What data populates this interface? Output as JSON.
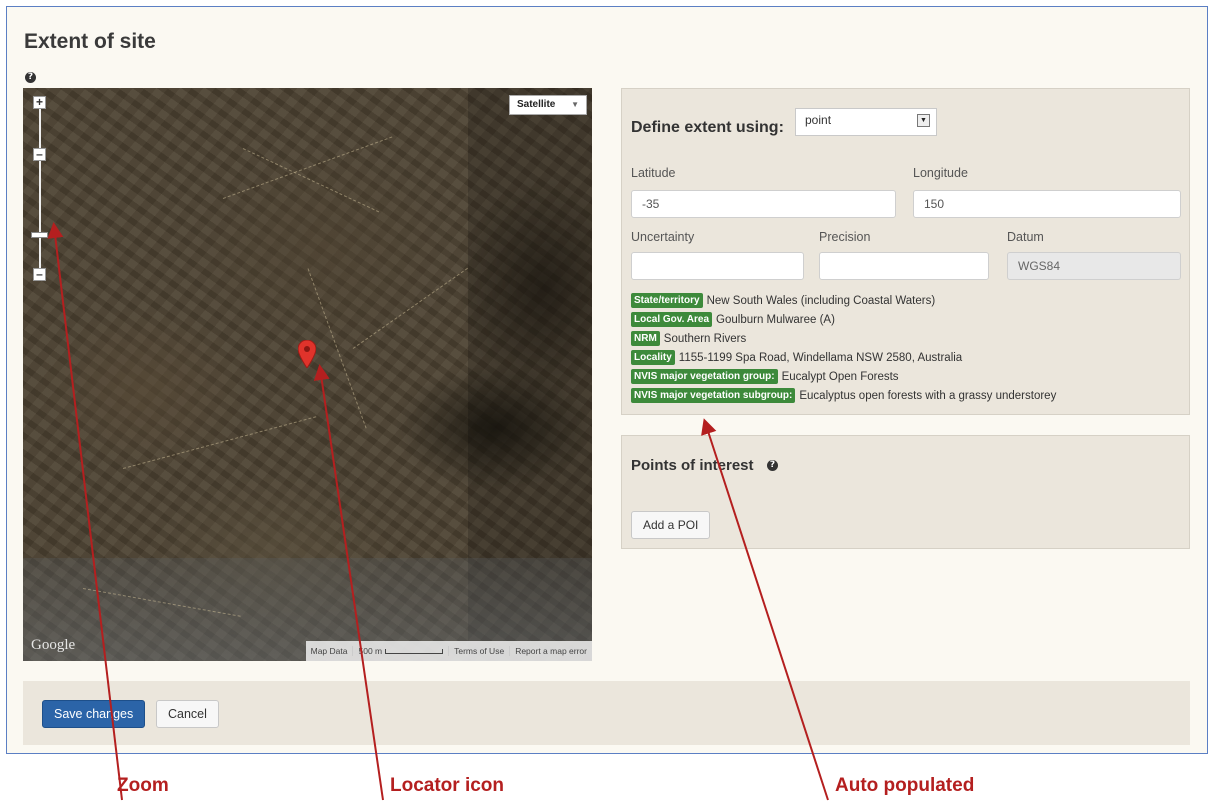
{
  "title": "Extent of site",
  "map": {
    "zoom_in": "+",
    "zoom_out": "–",
    "type_label": "Satellite",
    "logo": "Google",
    "attribution": [
      "Map Data",
      "500 m",
      "Terms of Use",
      "Report a map error"
    ]
  },
  "extent": {
    "label": "Define extent using:",
    "method": "point",
    "latitude_label": "Latitude",
    "latitude": "-35",
    "longitude_label": "Longitude",
    "longitude": "150",
    "uncertainty_label": "Uncertainty",
    "uncertainty": "",
    "precision_label": "Precision",
    "precision": "",
    "datum_label": "Datum",
    "datum": "WGS84",
    "facts": [
      {
        "tag": "State/territory",
        "value": "New South Wales (including Coastal Waters)"
      },
      {
        "tag": "Local Gov. Area",
        "value": "Goulburn Mulwaree (A)"
      },
      {
        "tag": "NRM",
        "value": "Southern Rivers"
      },
      {
        "tag": "Locality",
        "value": "1155-1199 Spa Road, Windellama NSW 2580, Australia"
      },
      {
        "tag": "NVIS major vegetation group:",
        "value": "Eucalypt Open Forests"
      },
      {
        "tag": "NVIS major vegetation subgroup:",
        "value": "Eucalyptus open forests with a grassy understorey"
      }
    ]
  },
  "poi": {
    "title": "Points of interest",
    "add_label": "Add a POI"
  },
  "footer": {
    "save_label": "Save changes",
    "cancel_label": "Cancel"
  },
  "callouts": {
    "zoom": "Zoom",
    "locator": "Locator icon",
    "auto": "Auto populated"
  },
  "colors": {
    "accent_blue": "#2b64a8",
    "tag_green": "#3d8a3b",
    "callout_red": "#b41f1f",
    "marker_red": "#e0332b"
  }
}
